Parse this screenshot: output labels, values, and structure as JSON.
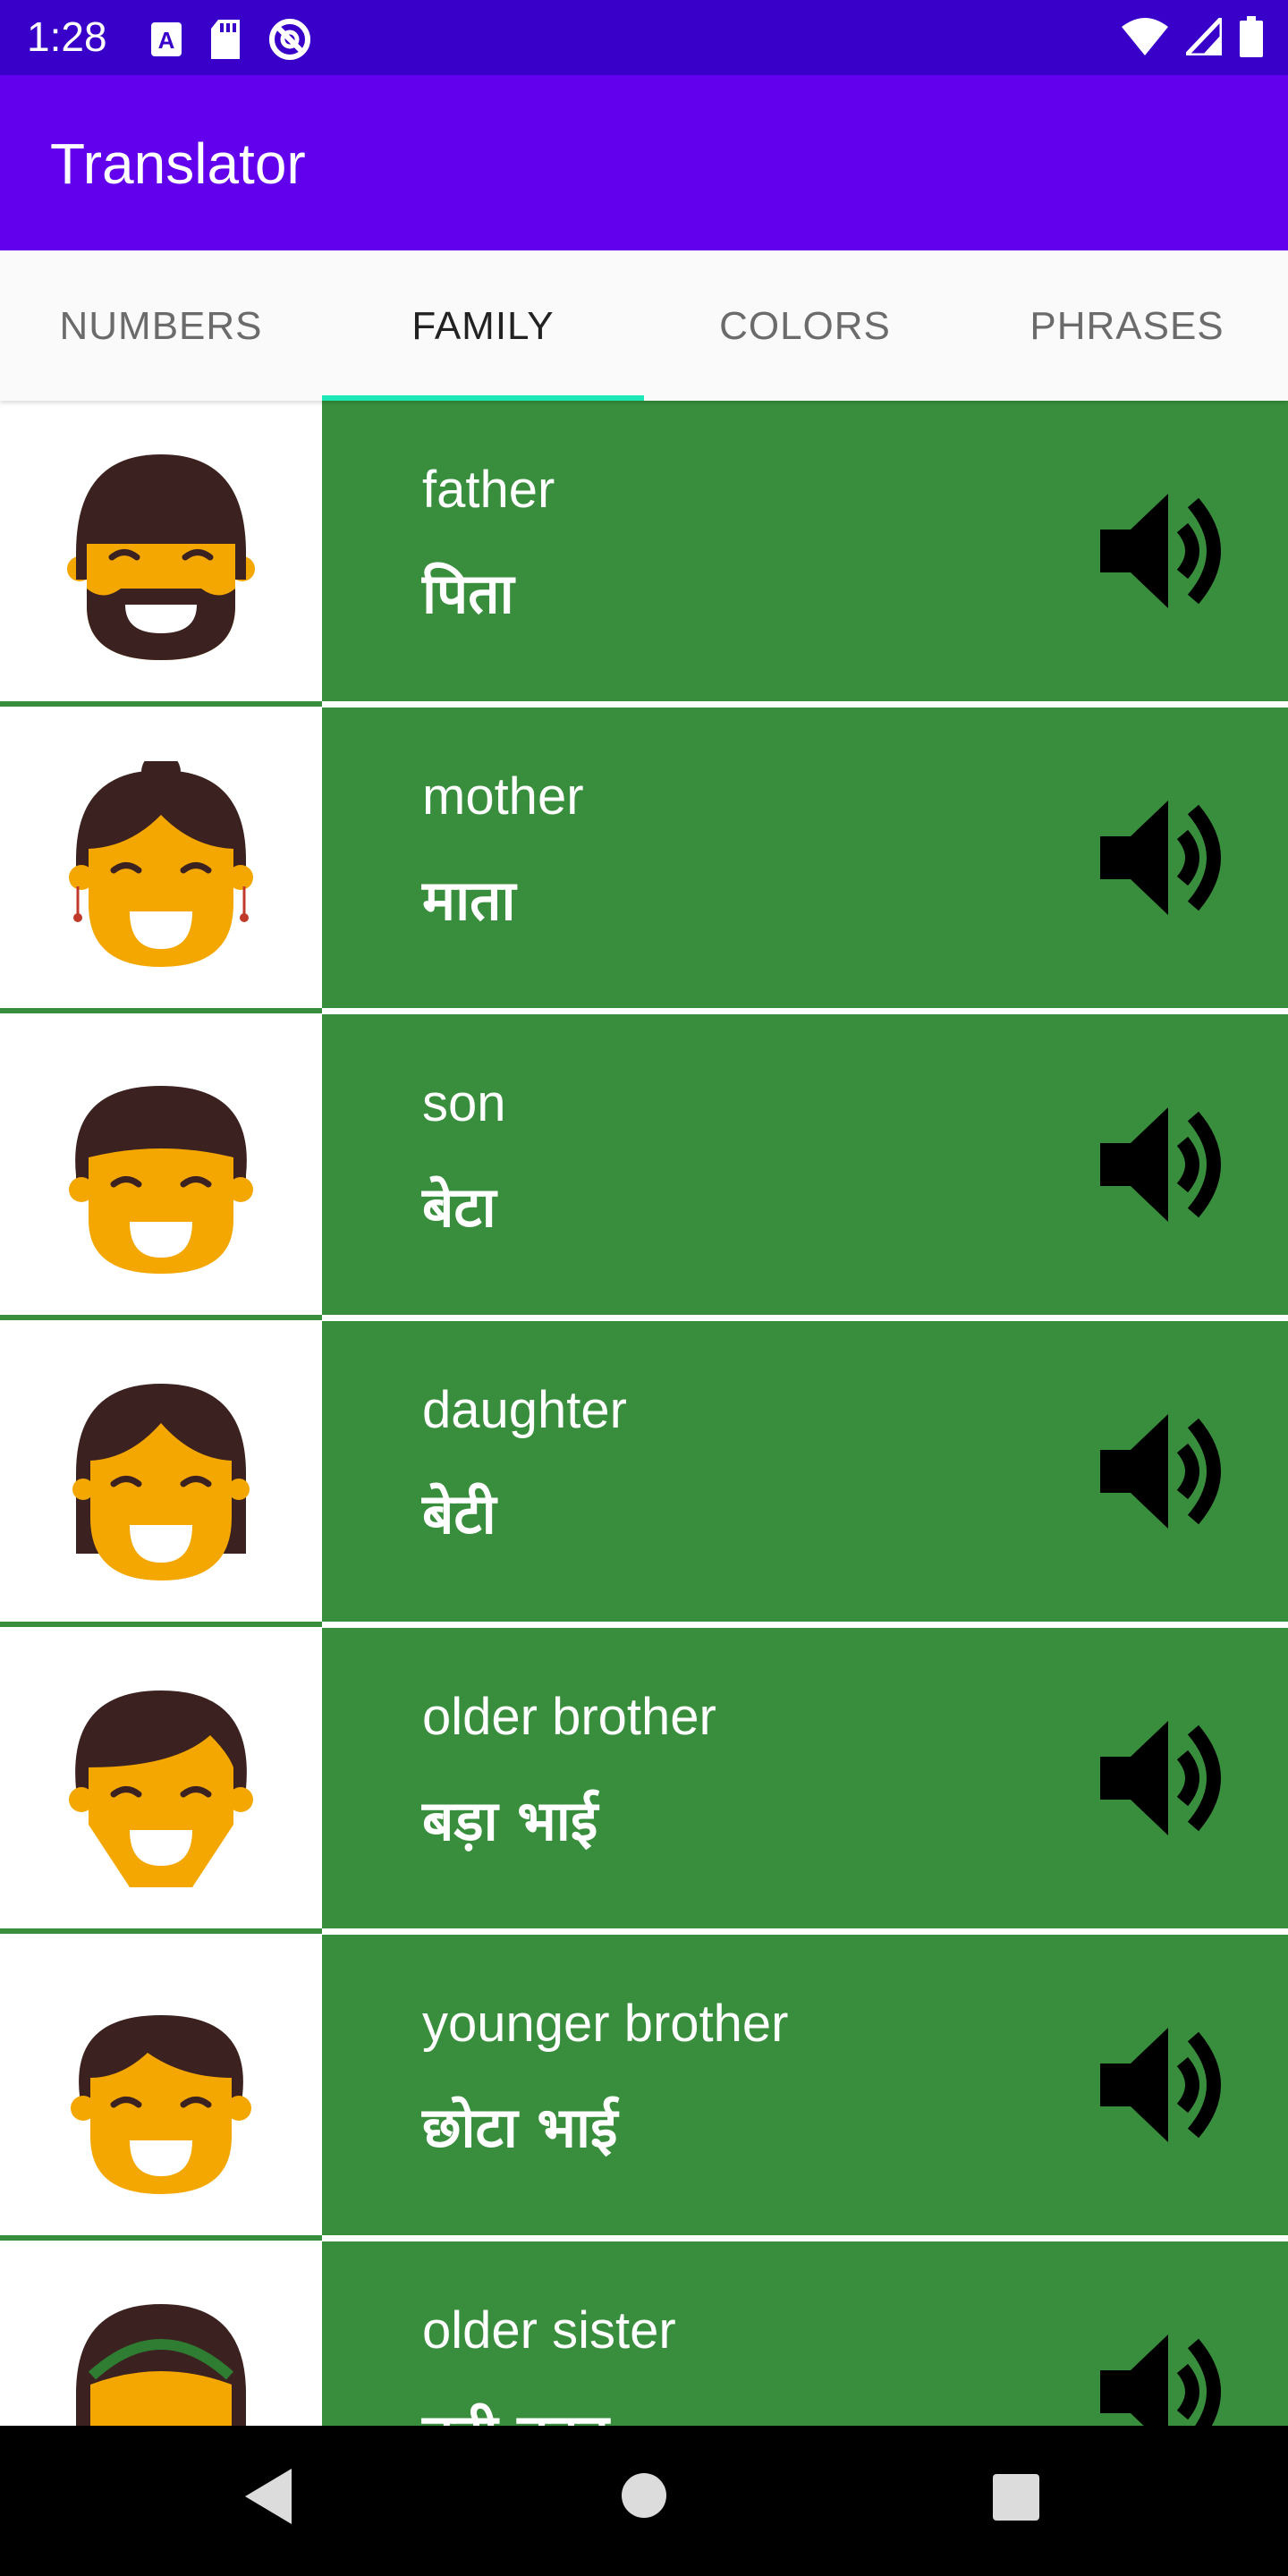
{
  "status_bar": {
    "time": "1:28",
    "icons_left": [
      "keyboard-a-icon",
      "sd-card-icon",
      "sync-disabled-icon"
    ],
    "icons_right": [
      "wifi-icon",
      "signal-icon",
      "battery-icon"
    ]
  },
  "app_bar": {
    "title": "Translator"
  },
  "tabs": [
    {
      "label": "NUMBERS",
      "active": false
    },
    {
      "label": "FAMILY",
      "active": true
    },
    {
      "label": "COLORS",
      "active": false
    },
    {
      "label": "PHRASES",
      "active": false
    }
  ],
  "colors": {
    "status_bar": "#3800c8",
    "app_bar": "#6200ee",
    "row_background": "#388e3c",
    "tab_indicator": "#1de9b6",
    "face_skin": "#f4a700",
    "hair": "#3b2220"
  },
  "words": [
    {
      "english": "father",
      "hindi": "पिता",
      "icon": "father-face-icon"
    },
    {
      "english": "mother",
      "hindi": "माता",
      "icon": "mother-face-icon"
    },
    {
      "english": "son",
      "hindi": "बेटा",
      "icon": "son-face-icon"
    },
    {
      "english": "daughter",
      "hindi": "बेटी",
      "icon": "daughter-face-icon"
    },
    {
      "english": "older brother",
      "hindi": "बड़ा भाई",
      "icon": "older-brother-face-icon"
    },
    {
      "english": "younger brother",
      "hindi": "छोटा भाई",
      "icon": "younger-brother-face-icon"
    },
    {
      "english": "older sister",
      "hindi": "बड़ी बहन",
      "icon": "older-sister-face-icon"
    }
  ],
  "nav_bar": {
    "buttons": [
      "back-icon",
      "home-icon",
      "recents-icon"
    ]
  }
}
